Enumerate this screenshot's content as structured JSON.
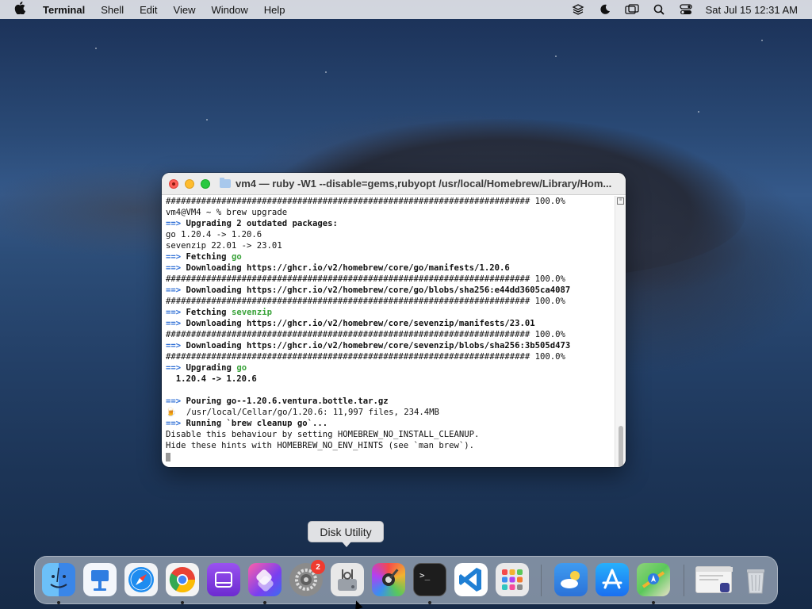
{
  "menubar": {
    "app_name": "Terminal",
    "items": [
      "Shell",
      "Edit",
      "View",
      "Window",
      "Help"
    ],
    "clock": "Sat Jul 15  12:31 AM"
  },
  "window": {
    "title": "vm4 — ruby -W1 --disable=gems,rubyopt /usr/local/Homebrew/Library/Hom..."
  },
  "terminal": {
    "hash_bar": "######################################################################## 100.0%",
    "prompt": "vm4@VM4 ~ % brew upgrade",
    "upgrading_outdated": "Upgrading 2 outdated packages:",
    "pkg_go": "go 1.20.4 -> 1.20.6",
    "pkg_sevenzip": "sevenzip 22.01 -> 23.01",
    "fetching": "Fetching",
    "go": "go",
    "sevenzip": "sevenzip",
    "dl_go_manifest": "Downloading https://ghcr.io/v2/homebrew/core/go/manifests/1.20.6",
    "dl_go_blob": "Downloading https://ghcr.io/v2/homebrew/core/go/blobs/sha256:e44dd3605ca4087",
    "dl_7z_manifest": "Downloading https://ghcr.io/v2/homebrew/core/sevenzip/manifests/23.01",
    "dl_7z_blob": "Downloading https://ghcr.io/v2/homebrew/core/sevenzip/blobs/sha256:3b505d473",
    "upgrading": "Upgrading",
    "version_change": "  1.20.4 -> 1.20.6",
    "pouring": "Pouring go--1.20.6.ventura.bottle.tar.gz",
    "beer": "🍺",
    "cellar": "  /usr/local/Cellar/go/1.20.6: 11,997 files, 234.4MB",
    "cleanup": "Running `brew cleanup go`...",
    "hint1": "Disable this behaviour by setting HOMEBREW_NO_INSTALL_CLEANUP.",
    "hint2": "Hide these hints with HOMEBREW_NO_ENV_HINTS (see `man brew`).",
    "arrow": "==> "
  },
  "tooltip": "Disk Utility",
  "dock": {
    "system_settings_badge": "2",
    "apps": [
      {
        "name": "finder-app",
        "color": "#3d8ef0"
      },
      {
        "name": "keynote-app",
        "color": "#2f7de1"
      },
      {
        "name": "safari-app",
        "color": "#1d8cf0"
      },
      {
        "name": "chrome-app",
        "color": "#e94235"
      },
      {
        "name": "podcasts-app",
        "color": "#8a3ee0"
      },
      {
        "name": "shortcuts-app",
        "color": "#b23fe0"
      },
      {
        "name": "system-settings-app",
        "color": "#8b8b8b"
      },
      {
        "name": "disk-utility-app",
        "color": "#d9d9d9"
      },
      {
        "name": "colorsync-app",
        "color": "#f2b230"
      },
      {
        "name": "terminal-app",
        "color": "#1d1d1d"
      },
      {
        "name": "vscode-app",
        "color": "#1f7fd4"
      },
      {
        "name": "launchpad-app",
        "color": "#e6e6e6"
      },
      {
        "name": "weather-app",
        "color": "#3f9bf0"
      },
      {
        "name": "app-store-app",
        "color": "#1e8ff5"
      },
      {
        "name": "maps-app",
        "color": "#5ac85a"
      },
      {
        "name": "recent-window-thumb",
        "color": "#f0f0f0"
      },
      {
        "name": "trash-app",
        "color": "#c8ccd2"
      }
    ]
  }
}
